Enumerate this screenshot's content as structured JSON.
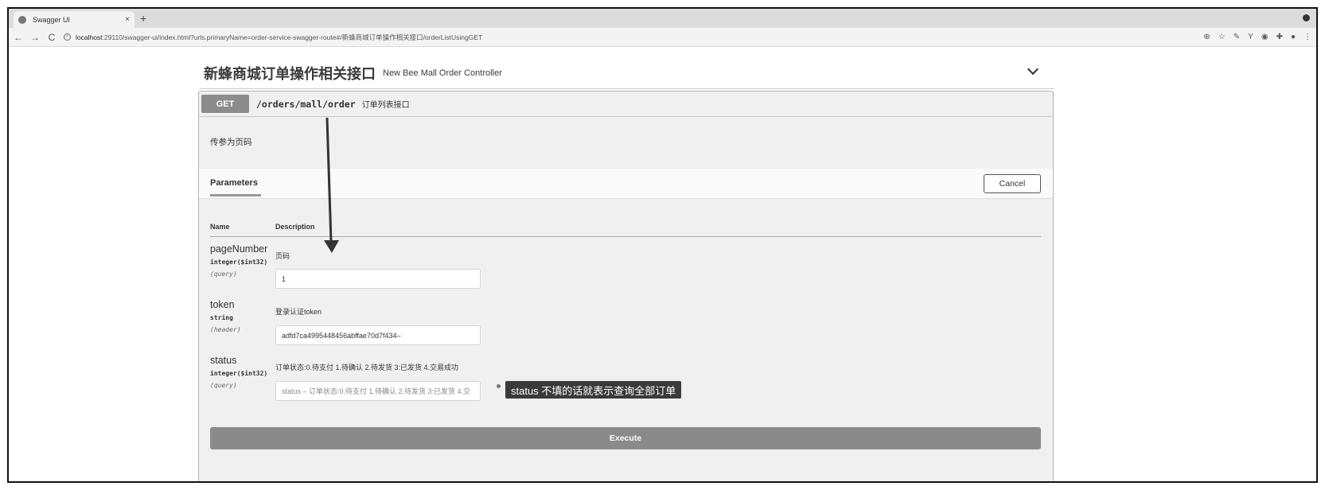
{
  "browser": {
    "tab_title": "Swagger UI",
    "tab_close": "×",
    "new_tab": "+",
    "url_host": "localhost",
    "url_rest": ":29110/swagger-ui/index.html?urls.primaryName=order-service-swagger-route#/新蜂商城订单操作相关接口/orderListUsingGET",
    "nav": {
      "back": "←",
      "forward": "→",
      "reload": "C"
    },
    "extensions": [
      "⊕",
      "☆",
      "✎",
      "Y",
      "◉",
      "✚",
      "●",
      "⋮"
    ]
  },
  "section": {
    "title": "新蜂商城订单操作相关接口",
    "description": "New Bee Mall Order Controller"
  },
  "operation": {
    "method": "GET",
    "path": "/orders/mall/order",
    "summary": "订单列表接口",
    "description": "传参为页码"
  },
  "parameters_tab": "Parameters",
  "cancel_label": "Cancel",
  "columns": {
    "name": "Name",
    "description": "Description"
  },
  "params": [
    {
      "name": "pageNumber",
      "type": "integer($int32)",
      "in": "(query)",
      "description": "页码",
      "value": "1",
      "placeholder": ""
    },
    {
      "name": "token",
      "type": "string",
      "in": "(header)",
      "description": "登录认证token",
      "value": "adfd7ca4995448456abffae70d7f434–",
      "placeholder": ""
    },
    {
      "name": "status",
      "type": "integer($int32)",
      "in": "(query)",
      "description": "订单状态:0.待支付 1.待确认 2.待发货 3:已发货 4.交易成功",
      "value": "",
      "placeholder": "status – 订单状态:0.待支付 1.待确认 2.待发货 3:已发货 4.交"
    }
  ],
  "execute_label": "Execute",
  "annotation": {
    "text": "status 不填的话就表示查询全部订单"
  }
}
